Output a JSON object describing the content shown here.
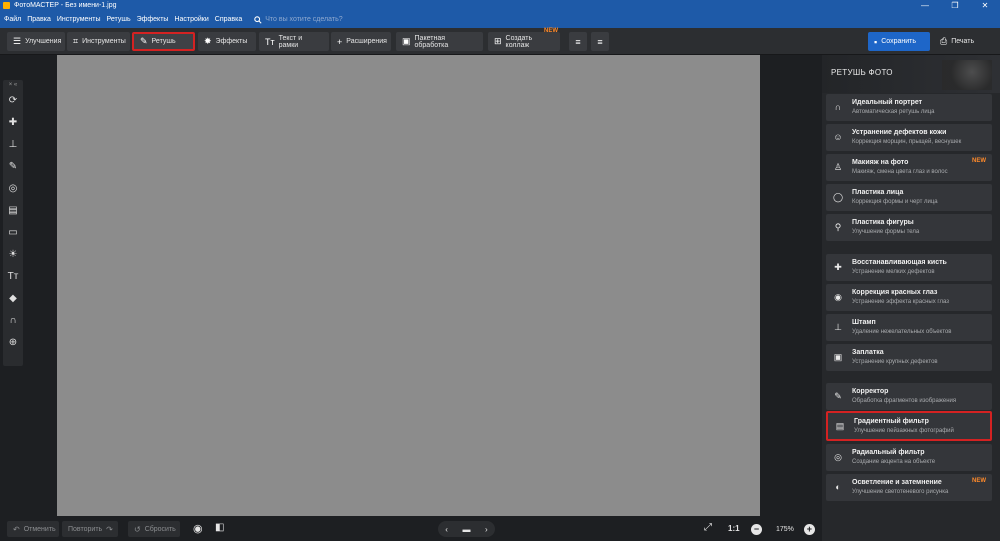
{
  "window": {
    "title": "ФотоМАСТЕР - Без имени-1.jpg",
    "minimize": "—",
    "maximize": "❐",
    "close": "✕"
  },
  "menu": {
    "items": [
      "Файл",
      "Правка",
      "Инструменты",
      "Ретушь",
      "Эффекты",
      "Настройки",
      "Справка"
    ],
    "search_placeholder": "Что вы хотите сделать?"
  },
  "toolbar": {
    "improve": "Улучшения",
    "tools": "Инструменты",
    "retouch": "Ретушь",
    "effects": "Эффекты",
    "text": "Текст и рамки",
    "extensions": "Расширения",
    "batch": "Пакетная обработка",
    "collage": "Создать коллаж",
    "collage_badge": "NEW",
    "save": "Сохранить",
    "print": "Печать"
  },
  "right_panel": {
    "heading": "РЕТУШЬ ФОТО",
    "items": [
      {
        "title": "Идеальный портрет",
        "subtitle": "Автоматическая ретушь лица",
        "icon": "face-icon",
        "badge": ""
      },
      {
        "title": "Устранение дефектов кожи",
        "subtitle": "Коррекция морщин, прыщей, веснушек",
        "icon": "skin-icon",
        "badge": ""
      },
      {
        "title": "Макияж на фото",
        "subtitle": "Макияж, смена цвета глаз и волос",
        "icon": "makeup-icon",
        "badge": "NEW"
      },
      {
        "title": "Пластика лица",
        "subtitle": "Коррекция формы и черт лица",
        "icon": "face-plastic-icon",
        "badge": ""
      },
      {
        "title": "Пластика фигуры",
        "subtitle": "Улучшение формы тела",
        "icon": "figure-icon",
        "badge": ""
      },
      {
        "title": "Восстанавливающая кисть",
        "subtitle": "Устранение мелких дефектов",
        "icon": "healing-brush-icon",
        "badge": ""
      },
      {
        "title": "Коррекция красных глаз",
        "subtitle": "Устранение эффекта красных глаз",
        "icon": "eye-icon",
        "badge": ""
      },
      {
        "title": "Штамп",
        "subtitle": "Удаление нежелательных объектов",
        "icon": "stamp-icon",
        "badge": ""
      },
      {
        "title": "Заплатка",
        "subtitle": "Устранение крупных дефектов",
        "icon": "patch-icon",
        "badge": ""
      },
      {
        "title": "Корректор",
        "subtitle": "Обработка фрагментов изображения",
        "icon": "brush-icon",
        "badge": ""
      },
      {
        "title": "Градиентный фильтр",
        "subtitle": "Улучшение пейзажных фотографий",
        "icon": "gradient-icon",
        "badge": ""
      },
      {
        "title": "Радиальный фильтр",
        "subtitle": "Создание акцента на объекте",
        "icon": "radial-icon",
        "badge": ""
      },
      {
        "title": "Осветление и затемнение",
        "subtitle": "Улучшение светотеневого рисунка",
        "icon": "dodge-burn-icon",
        "badge": "NEW"
      }
    ]
  },
  "bottom": {
    "undo": "Отменить",
    "redo": "Повторить",
    "reset": "Сбросить",
    "ratio": "1:1",
    "zoom": "175%"
  },
  "colors": {
    "accent": "#1e66c8",
    "highlight": "#d42222",
    "badge": "#ff8a2a"
  }
}
